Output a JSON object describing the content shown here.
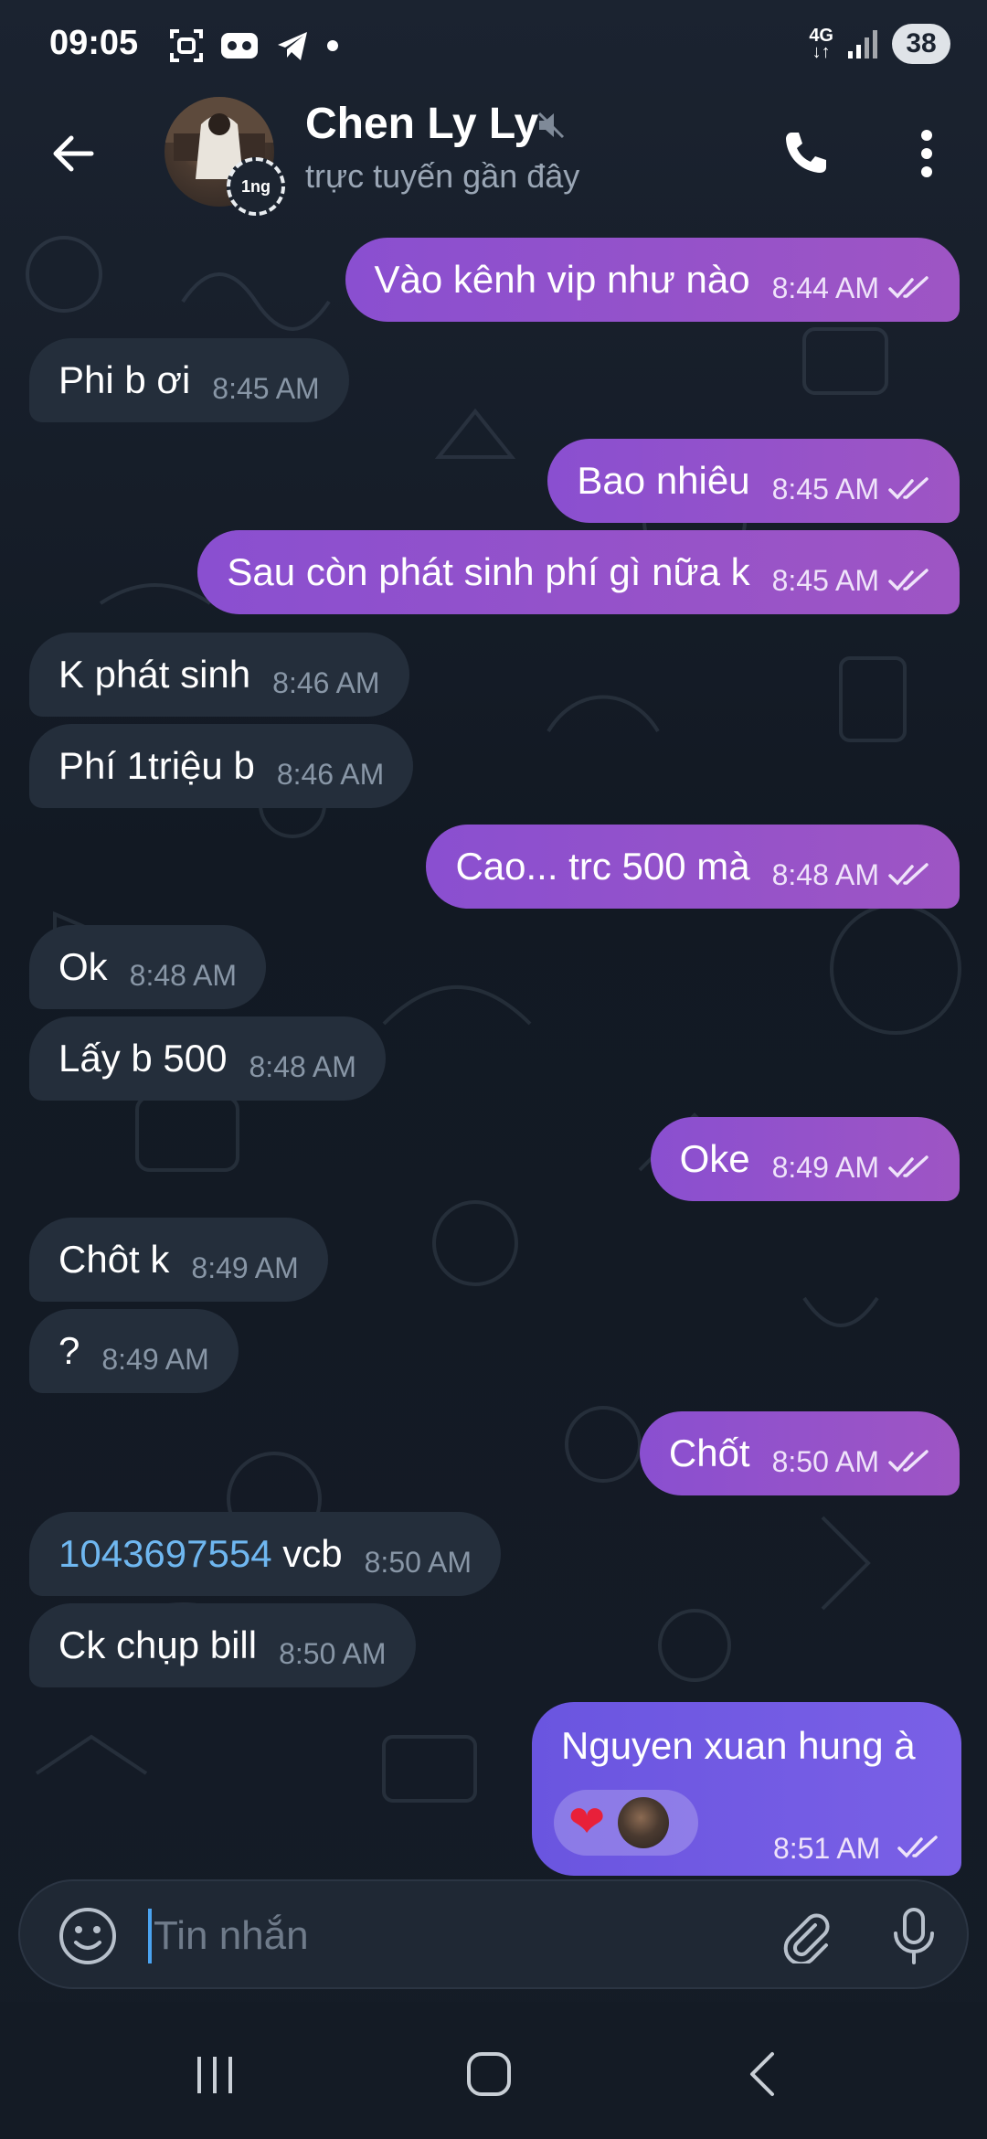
{
  "status_bar": {
    "time": "09:05",
    "network": "4G",
    "battery": "38"
  },
  "header": {
    "name": "Chen Ly Ly",
    "status": "trực tuyến gần đây",
    "avatar_badge": "1ng"
  },
  "messages": [
    {
      "dir": "out",
      "text": "Vào kênh vip như nào",
      "time": "8:44 AM"
    },
    {
      "dir": "in",
      "text": "Phi b ơi",
      "time": "8:45 AM"
    },
    {
      "dir": "out",
      "text": "Bao nhiêu",
      "time": "8:45 AM"
    },
    {
      "dir": "out",
      "text": "Sau còn phát sinh phí gì nữa k",
      "time": "8:45 AM"
    },
    {
      "dir": "in",
      "text": "K phát sinh",
      "time": "8:46 AM"
    },
    {
      "dir": "in",
      "text": "Phí 1triệu b",
      "time": "8:46 AM"
    },
    {
      "dir": "out",
      "text": "Cao... trc 500 mà",
      "time": "8:48 AM"
    },
    {
      "dir": "in",
      "text": "Ok",
      "time": "8:48 AM"
    },
    {
      "dir": "in",
      "text": "Lấy b 500",
      "time": "8:48 AM"
    },
    {
      "dir": "out",
      "text": "Oke",
      "time": "8:49 AM"
    },
    {
      "dir": "in",
      "text": "Chôt k",
      "time": "8:49 AM"
    },
    {
      "dir": "in",
      "text": "?",
      "time": "8:49 AM"
    },
    {
      "dir": "out",
      "text": "Chốt",
      "time": "8:50 AM"
    },
    {
      "dir": "in",
      "link": "1043697554",
      "text": " vcb",
      "time": "8:50 AM"
    },
    {
      "dir": "in",
      "text": "Ck chụp bill",
      "time": "8:50 AM"
    }
  ],
  "last_message": {
    "text": "Nguyen xuan hung à",
    "time": "8:51 AM",
    "reaction": "❤"
  },
  "composer": {
    "placeholder": "Tin nhắn"
  },
  "colors": {
    "outgoing": "#9b54c8",
    "incoming": "#242e3b",
    "link": "#6fb7f0",
    "last_outgoing": "#6f5ae3"
  }
}
